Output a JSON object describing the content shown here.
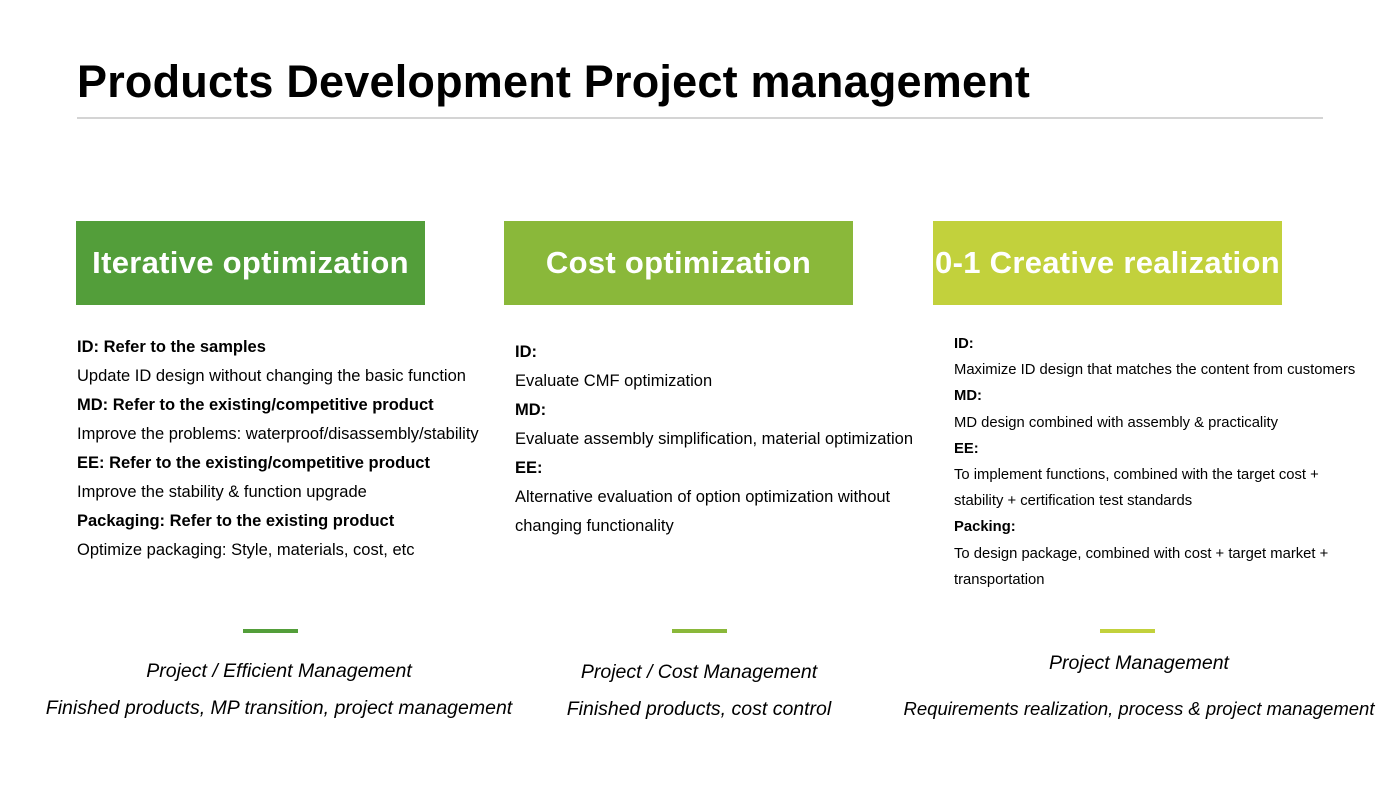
{
  "title": "Products Development Project management",
  "colors": {
    "col1": "#539e3a",
    "col2": "#8ab83a",
    "col3": "#c2d13c",
    "rule": "#d4d4d4"
  },
  "columns": [
    {
      "header": "Iterative optimization",
      "lines": [
        {
          "text": "ID: Refer to the samples",
          "bold": true
        },
        {
          "text": "Update ID design without changing the basic function",
          "bold": false
        },
        {
          "text": "MD: Refer to the existing/competitive product",
          "bold": true
        },
        {
          "text": "Improve the problems: waterproof/disassembly/stability",
          "bold": false
        },
        {
          "text": "EE: Refer to the existing/competitive product",
          "bold": true
        },
        {
          "text": "Improve the stability & function upgrade",
          "bold": false
        },
        {
          "text": "Packaging: Refer to the existing product",
          "bold": true
        },
        {
          "text": "Optimize packaging: Style, materials, cost, etc",
          "bold": false
        }
      ],
      "footer": [
        "Project / Efficient Management",
        "Finished products, MP transition, project management"
      ]
    },
    {
      "header": "Cost optimization",
      "lines": [
        {
          "text": "ID:",
          "bold": true
        },
        {
          "text": "Evaluate CMF optimization",
          "bold": false
        },
        {
          "text": "MD:",
          "bold": true
        },
        {
          "text": "Evaluate assembly simplification, material optimization",
          "bold": false
        },
        {
          "text": "EE:",
          "bold": true
        },
        {
          "text": "Alternative evaluation of option optimization without",
          "bold": false
        },
        {
          "text": "changing functionality",
          "bold": false
        }
      ],
      "footer": [
        "Project  / Cost Management",
        "Finished products, cost control"
      ]
    },
    {
      "header": "0-1 Creative realization",
      "lines": [
        {
          "text": "ID:",
          "bold": true
        },
        {
          "text": "Maximize ID design that matches the content from customers",
          "bold": false
        },
        {
          "text": "MD:",
          "bold": true
        },
        {
          "text": "MD design combined with assembly & practicality",
          "bold": false
        },
        {
          "text": "EE:",
          "bold": true
        },
        {
          "text": "To implement functions, combined with the target cost +",
          "bold": false
        },
        {
          "text": "stability + certification test standards",
          "bold": false
        },
        {
          "text": "Packing:",
          "bold": true
        },
        {
          "text": "To design package, combined with cost + target market +",
          "bold": false
        },
        {
          "text": "transportation",
          "bold": false
        }
      ],
      "footer": [
        "Project  Management",
        "Requirements realization, process & project management"
      ]
    }
  ]
}
